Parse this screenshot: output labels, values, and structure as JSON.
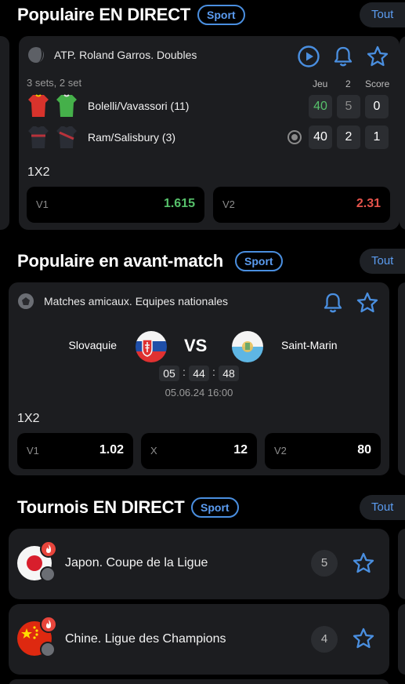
{
  "live": {
    "title": "Populaire EN DIRECT",
    "sport_label": "Sport",
    "all_label": "Tout",
    "match": {
      "league": "ATP. Roland Garros. Doubles",
      "status": "3 sets, 2 set",
      "col_game": "Jeu",
      "col_set": "2",
      "col_score": "Score",
      "team1": {
        "name": "Bolelli/Vavassori (11)",
        "game": "40",
        "set": "5",
        "score": "0"
      },
      "team2": {
        "name": "Ram/Salisbury (3)",
        "game": "40",
        "set": "2",
        "score": "1"
      },
      "market": "1X2",
      "odds": [
        {
          "label": "V1",
          "value": "1.615",
          "color": "#56c06a"
        },
        {
          "label": "V2",
          "value": "2.31",
          "color": "#e5534b"
        }
      ]
    }
  },
  "prematch": {
    "title": "Populaire en avant-match",
    "sport_label": "Sport",
    "all_label": "Tout",
    "match": {
      "league": "Matches amicaux. Equipes nationales",
      "home": "Slovaquie",
      "vs": "VS",
      "away": "Saint-Marin",
      "timer": {
        "h": "05",
        "m": "44",
        "s": "48"
      },
      "sep": ":",
      "datetime": "05.06.24 16:00",
      "market": "1X2",
      "odds": [
        {
          "label": "V1",
          "value": "1.02"
        },
        {
          "label": "X",
          "value": "12"
        },
        {
          "label": "V2",
          "value": "80"
        }
      ]
    }
  },
  "tournaments": {
    "title": "Tournois EN DIRECT",
    "sport_label": "Sport",
    "all_label": "Tout",
    "items": [
      {
        "name": "Japon. Coupe de la Ligue",
        "count": "5",
        "flag": "japan"
      },
      {
        "name": "Chine. Ligue des Champions",
        "count": "4",
        "flag": "china"
      }
    ]
  },
  "colors": {
    "accent": "#4a8fe0",
    "card": "#1c1d20",
    "green": "#56c06a",
    "red": "#e5534b"
  }
}
